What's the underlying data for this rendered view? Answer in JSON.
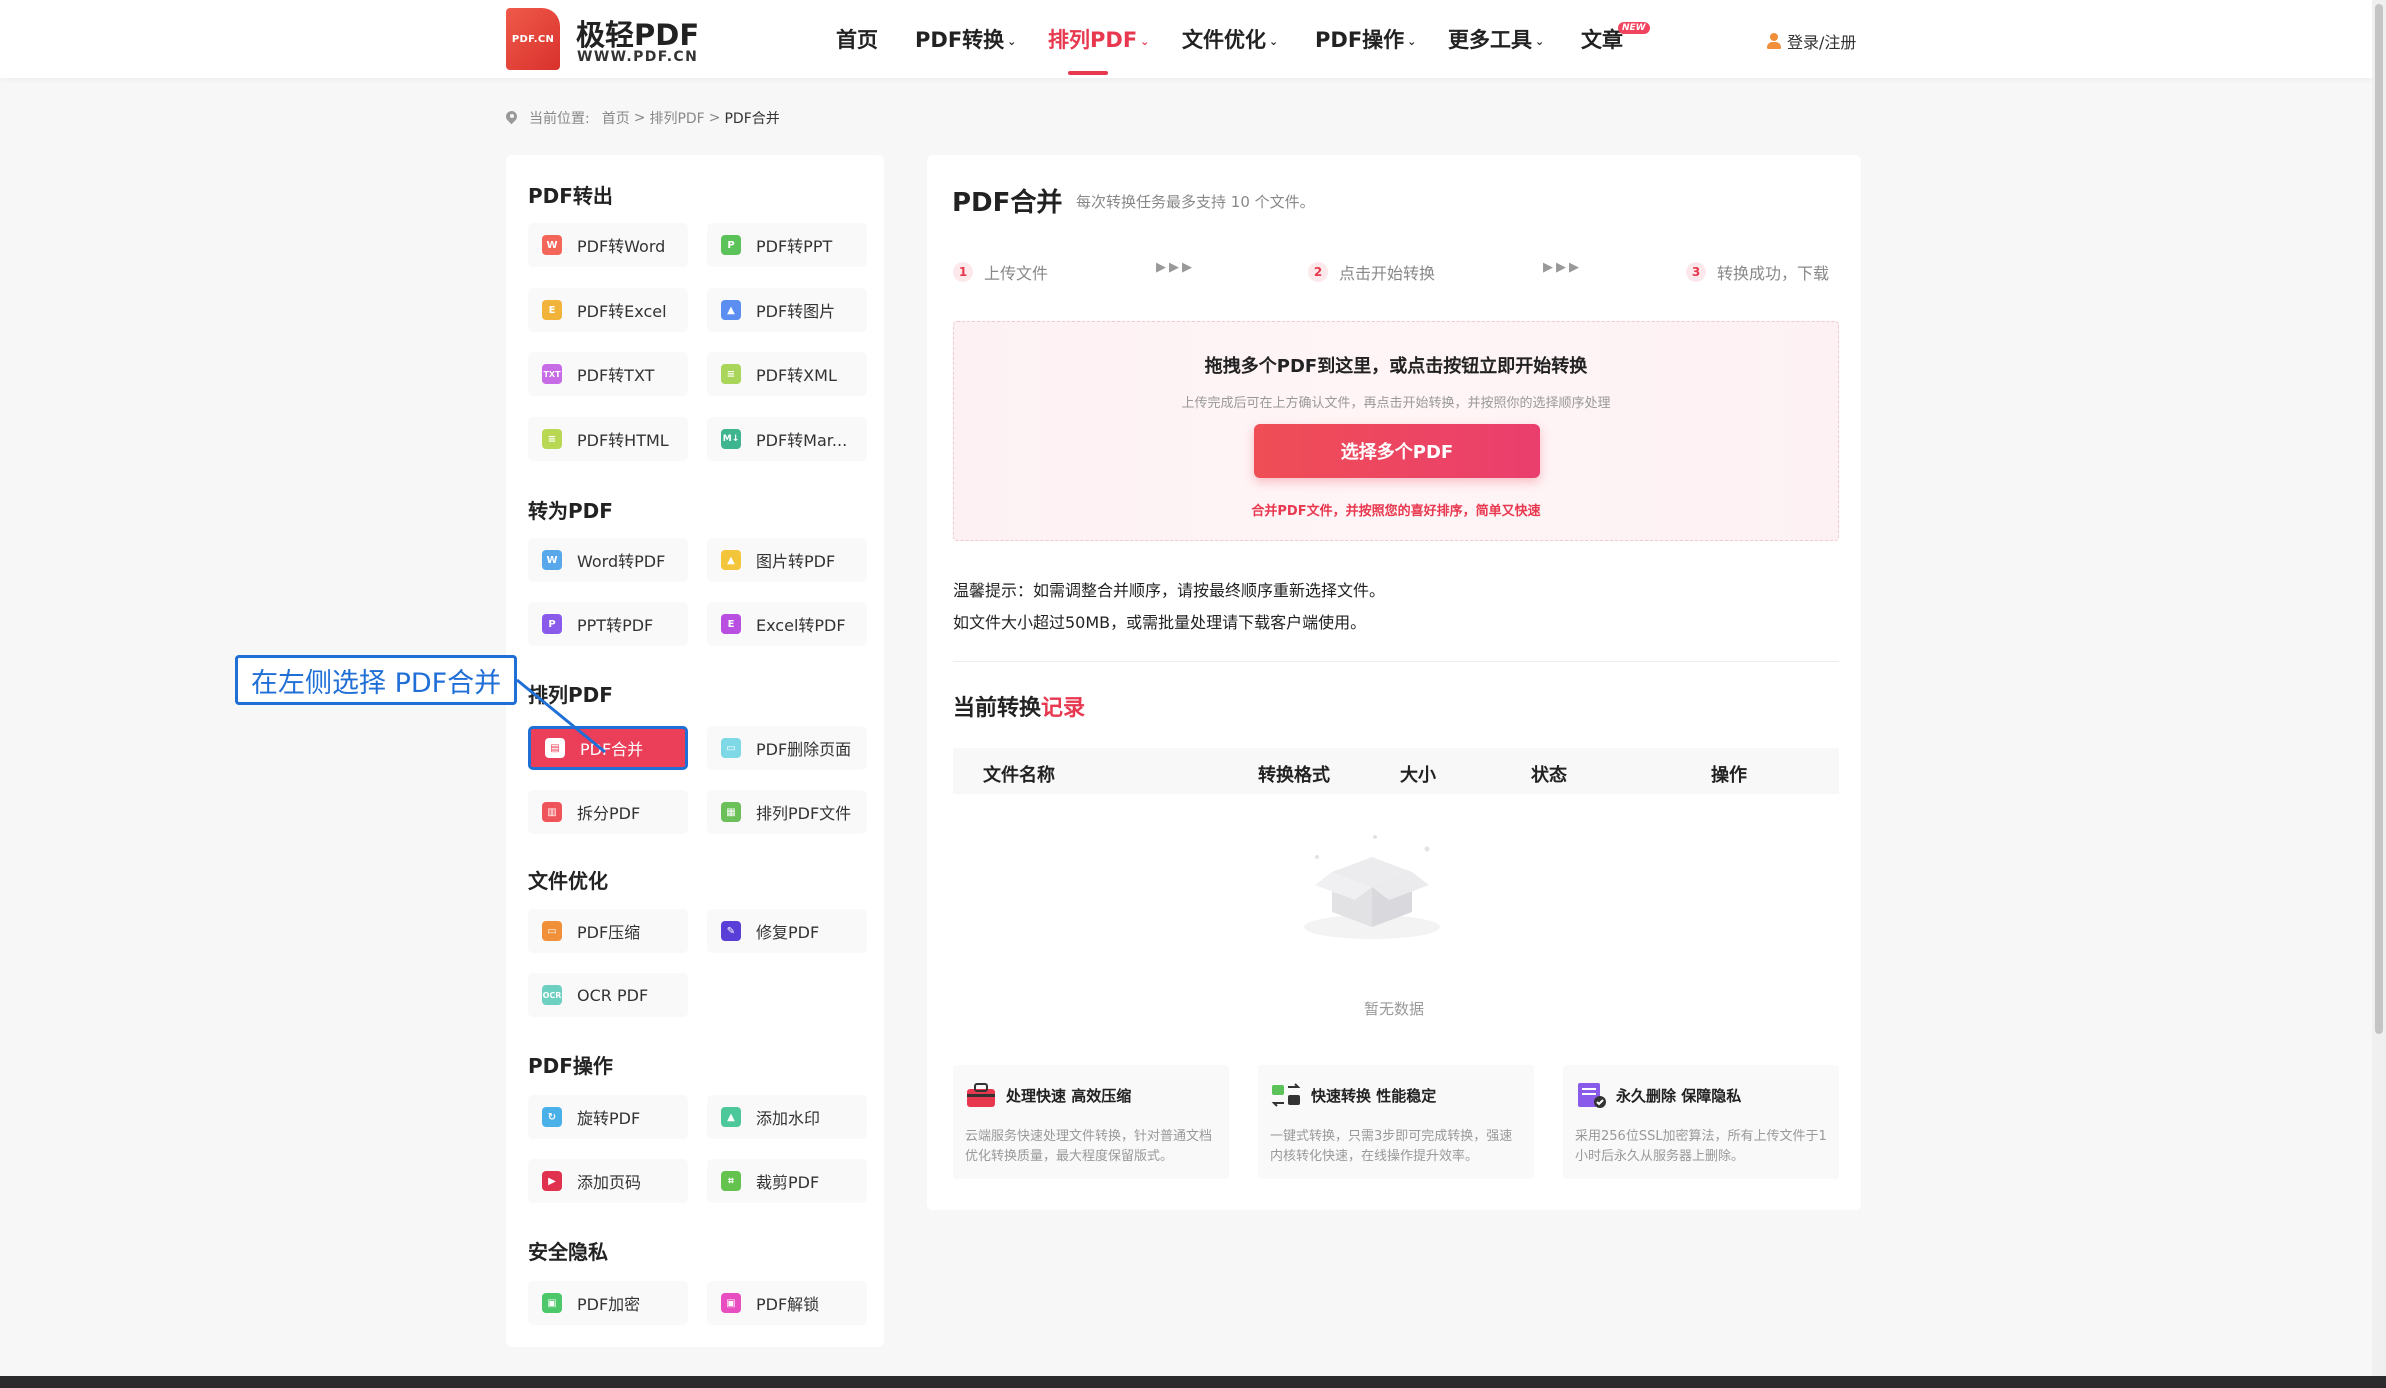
{
  "header": {
    "logo_badge": "PDF.CN",
    "logo_title": "极轻PDF",
    "logo_sub": "WWW.PDF.CN",
    "nav": [
      {
        "label": "首页",
        "dropdown": false
      },
      {
        "label": "PDF转换",
        "dropdown": true
      },
      {
        "label": "排列PDF",
        "dropdown": true,
        "active": true
      },
      {
        "label": "文件优化",
        "dropdown": true
      },
      {
        "label": "PDF操作",
        "dropdown": true
      },
      {
        "label": "更多工具",
        "dropdown": true
      },
      {
        "label": "文章",
        "dropdown": false
      }
    ],
    "new_badge": "NEW",
    "login": "登录/注册"
  },
  "breadcrumb": {
    "prefix": "当前位置:",
    "home": "首页",
    "sep": ">",
    "parent": "排列PDF",
    "current": "PDF合并"
  },
  "sidebar": {
    "sections": [
      {
        "title": "PDF转出",
        "tools": [
          "PDF转Word",
          "PDF转PPT",
          "PDF转Excel",
          "PDF转图片",
          "PDF转TXT",
          "PDF转XML",
          "PDF转HTML",
          "PDF转Mar..."
        ]
      },
      {
        "title": "转为PDF",
        "tools": [
          "Word转PDF",
          "图片转PDF",
          "PPT转PDF",
          "Excel转PDF"
        ]
      },
      {
        "title": "排列PDF",
        "tools": [
          "PDF合并",
          "PDF删除页面",
          "拆分PDF",
          "排列PDF文件"
        ]
      },
      {
        "title": "文件优化",
        "tools": [
          "PDF压缩",
          "修复PDF",
          "OCR PDF"
        ]
      },
      {
        "title": "PDF操作",
        "tools": [
          "旋转PDF",
          "添加水印",
          "添加页码",
          "裁剪PDF"
        ]
      },
      {
        "title": "安全隐私",
        "tools": [
          "PDF加密",
          "PDF解锁"
        ]
      }
    ]
  },
  "annotation": "在左侧选择 PDF合并",
  "main": {
    "title": "PDF合并",
    "subtitle": "每次转换任务最多支持 10 个文件。",
    "steps": [
      {
        "num": "1",
        "label": "上传文件"
      },
      {
        "num": "2",
        "label": "点击开始转换"
      },
      {
        "num": "3",
        "label": "转换成功，下载"
      }
    ],
    "step_arrows": "▶▶▶",
    "drop": {
      "title": "拖拽多个PDF到这里，或点击按钮立即开始转换",
      "sub": "上传完成后可在上方确认文件，再点击开始转换，并按照你的选择顺序处理",
      "button": "选择多个PDF",
      "note": "合并PDF文件，并按照您的喜好排序，简单又快速"
    },
    "tips": [
      "温馨提示：如需调整合并顺序，请按最终顺序重新选择文件。",
      "如文件大小超过50MB，或需批量处理请下载客户端使用。"
    ],
    "records_title_a": "当前转换",
    "records_title_b": "记录",
    "table_headers": [
      "文件名称",
      "转换格式",
      "大小",
      "状态",
      "操作"
    ],
    "empty_text": "暂无数据",
    "features": [
      {
        "title": "处理快速 高效压缩",
        "desc": "云端服务快速处理文件转换，针对普通文档优化转换质量，最大程度保留版式。"
      },
      {
        "title": "快速转换 性能稳定",
        "desc": "一键式转换，只需3步即可完成转换，强速内核转化快速，在线操作提升效率。"
      },
      {
        "title": "永久删除 保障隐私",
        "desc": "采用256位SSL加密算法，所有上传文件于1小时后永久从服务器上删除。"
      }
    ]
  },
  "colors": {
    "accent": "#e8384f",
    "annotation": "#1f6fd6"
  }
}
